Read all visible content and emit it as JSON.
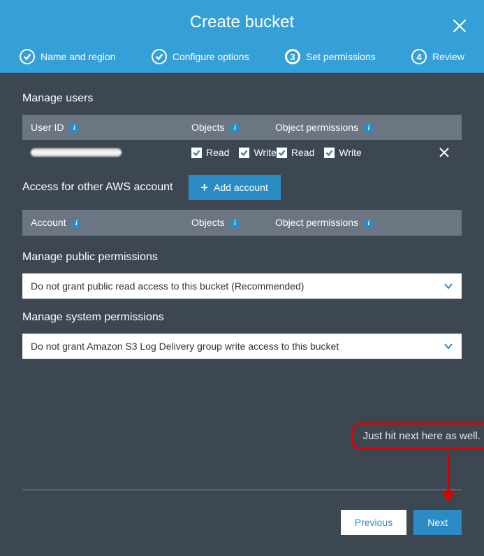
{
  "header": {
    "title": "Create bucket"
  },
  "steps": [
    {
      "label": "Name and region",
      "done": true
    },
    {
      "label": "Configure options",
      "done": true
    },
    {
      "num": "3",
      "label": "Set permissions",
      "active": true
    },
    {
      "num": "4",
      "label": "Review"
    }
  ],
  "sections": {
    "manage_users_title": "Manage users",
    "user_table": {
      "headers": {
        "user_id": "User ID",
        "objects": "Objects",
        "object_perms": "Object permissions"
      },
      "row": {
        "checks": {
          "read1_label": "Read",
          "write1_label": "Write",
          "read2_label": "Read",
          "write2_label": "Write"
        }
      }
    },
    "access_other_title": "Access for other AWS account",
    "add_account_label": "Add account",
    "account_table": {
      "headers": {
        "account": "Account",
        "objects": "Objects",
        "object_perms": "Object permissions"
      }
    },
    "public_title": "Manage public permissions",
    "public_select": "Do not grant public read access to this bucket (Recommended)",
    "system_title": "Manage system permissions",
    "system_select": "Do not grant Amazon S3 Log Delivery group write access to this bucket"
  },
  "annotation": "Just hit next here as well.",
  "footer": {
    "previous": "Previous",
    "next": "Next"
  }
}
